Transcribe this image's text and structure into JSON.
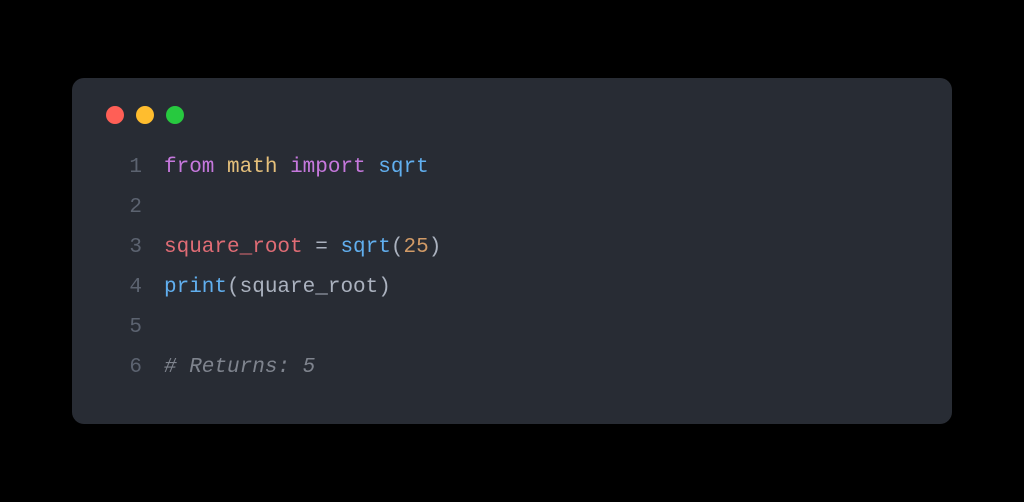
{
  "window": {
    "traffic_lights": [
      {
        "name": "close",
        "color": "#ff5f56"
      },
      {
        "name": "minimize",
        "color": "#ffbd2e"
      },
      {
        "name": "zoom",
        "color": "#27c93f"
      }
    ]
  },
  "code": {
    "lines": [
      {
        "number": "1",
        "tokens": [
          {
            "text": "from",
            "cls": "tok-keyword"
          },
          {
            "text": " ",
            "cls": "tok-plain"
          },
          {
            "text": "math",
            "cls": "tok-module"
          },
          {
            "text": " ",
            "cls": "tok-plain"
          },
          {
            "text": "import",
            "cls": "tok-keyword"
          },
          {
            "text": " ",
            "cls": "tok-plain"
          },
          {
            "text": "sqrt",
            "cls": "tok-builtin"
          }
        ]
      },
      {
        "number": "2",
        "tokens": []
      },
      {
        "number": "3",
        "tokens": [
          {
            "text": "square_root",
            "cls": "tok-ident"
          },
          {
            "text": " ",
            "cls": "tok-plain"
          },
          {
            "text": "=",
            "cls": "tok-punct"
          },
          {
            "text": " ",
            "cls": "tok-plain"
          },
          {
            "text": "sqrt",
            "cls": "tok-func"
          },
          {
            "text": "(",
            "cls": "tok-punct"
          },
          {
            "text": "25",
            "cls": "tok-number"
          },
          {
            "text": ")",
            "cls": "tok-punct"
          }
        ]
      },
      {
        "number": "4",
        "tokens": [
          {
            "text": "print",
            "cls": "tok-func"
          },
          {
            "text": "(",
            "cls": "tok-punct"
          },
          {
            "text": "square_root",
            "cls": "tok-plain"
          },
          {
            "text": ")",
            "cls": "tok-punct"
          }
        ]
      },
      {
        "number": "5",
        "tokens": []
      },
      {
        "number": "6",
        "tokens": [
          {
            "text": "# Returns: 5",
            "cls": "tok-comment"
          }
        ]
      }
    ]
  }
}
